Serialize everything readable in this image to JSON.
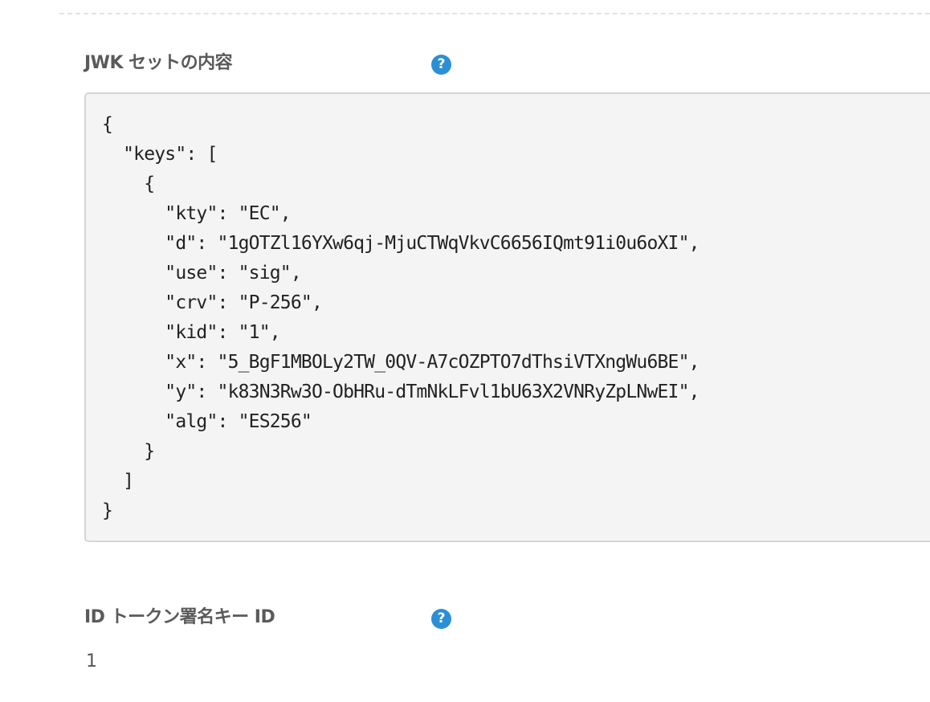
{
  "jwk_set": {
    "label": "JWK セットの内容",
    "help_icon": "?",
    "content": "{\n  \"keys\": [\n    {\n      \"kty\": \"EC\",\n      \"d\": \"1gOTZl16YXw6qj-MjuCTWqVkvC6656IQmt91i0u6oXI\",\n      \"use\": \"sig\",\n      \"crv\": \"P-256\",\n      \"kid\": \"1\",\n      \"x\": \"5_BgF1MBOLy2TW_0QV-A7cOZPTO7dThsiVTXngWu6BE\",\n      \"y\": \"k83N3Rw3O-ObHRu-dTmNkLFvl1bU63X2VNRyZpLNwEI\",\n      \"alg\": \"ES256\"\n    }\n  ]\n}"
  },
  "id_token_key": {
    "label": "ID トークン署名キー ID",
    "help_icon": "?",
    "value": "1"
  },
  "colors": {
    "help_icon": "#2b8fd6",
    "code_background": "#f4f4f4",
    "code_border": "#d6d6d6"
  }
}
